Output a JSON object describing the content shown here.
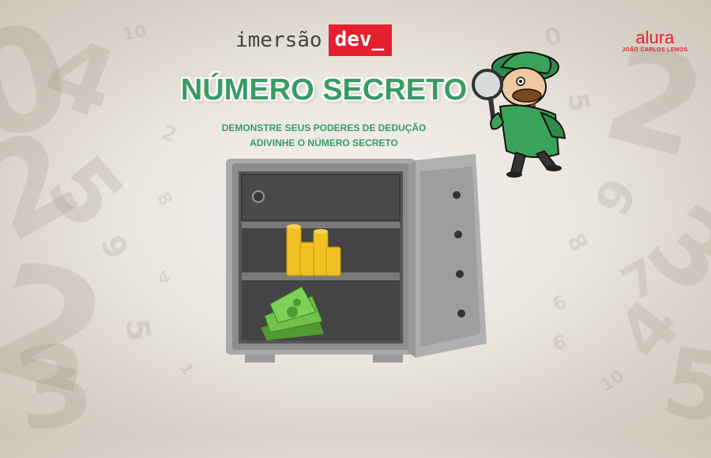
{
  "header": {
    "logo_text": "imersão",
    "logo_badge": "dev_"
  },
  "brand": {
    "name": "alura",
    "author": "JOÃO CARLOS LEMOS"
  },
  "main": {
    "title": "NÚMERO SECRETO",
    "subtitle_line1": "DEMONSTRE SEUS PODERES DE DEDUÇÃO",
    "subtitle_line2": "ADIVINHE O NÚMERO SECRETO"
  },
  "background_numbers": [
    "0",
    "1",
    "2",
    "3",
    "4",
    "5",
    "6",
    "7",
    "8",
    "9",
    "10"
  ],
  "colors": {
    "accent_green": "#3a9b64",
    "brand_red": "#e5202e",
    "safe_gray": "#8a8a8a",
    "coin_gold": "#f2c023",
    "cash_green": "#6fc24a"
  },
  "icons": [
    "safe-icon",
    "gold-coins-icon",
    "money-stack-icon",
    "detective-icon",
    "magnifying-glass-icon"
  ]
}
